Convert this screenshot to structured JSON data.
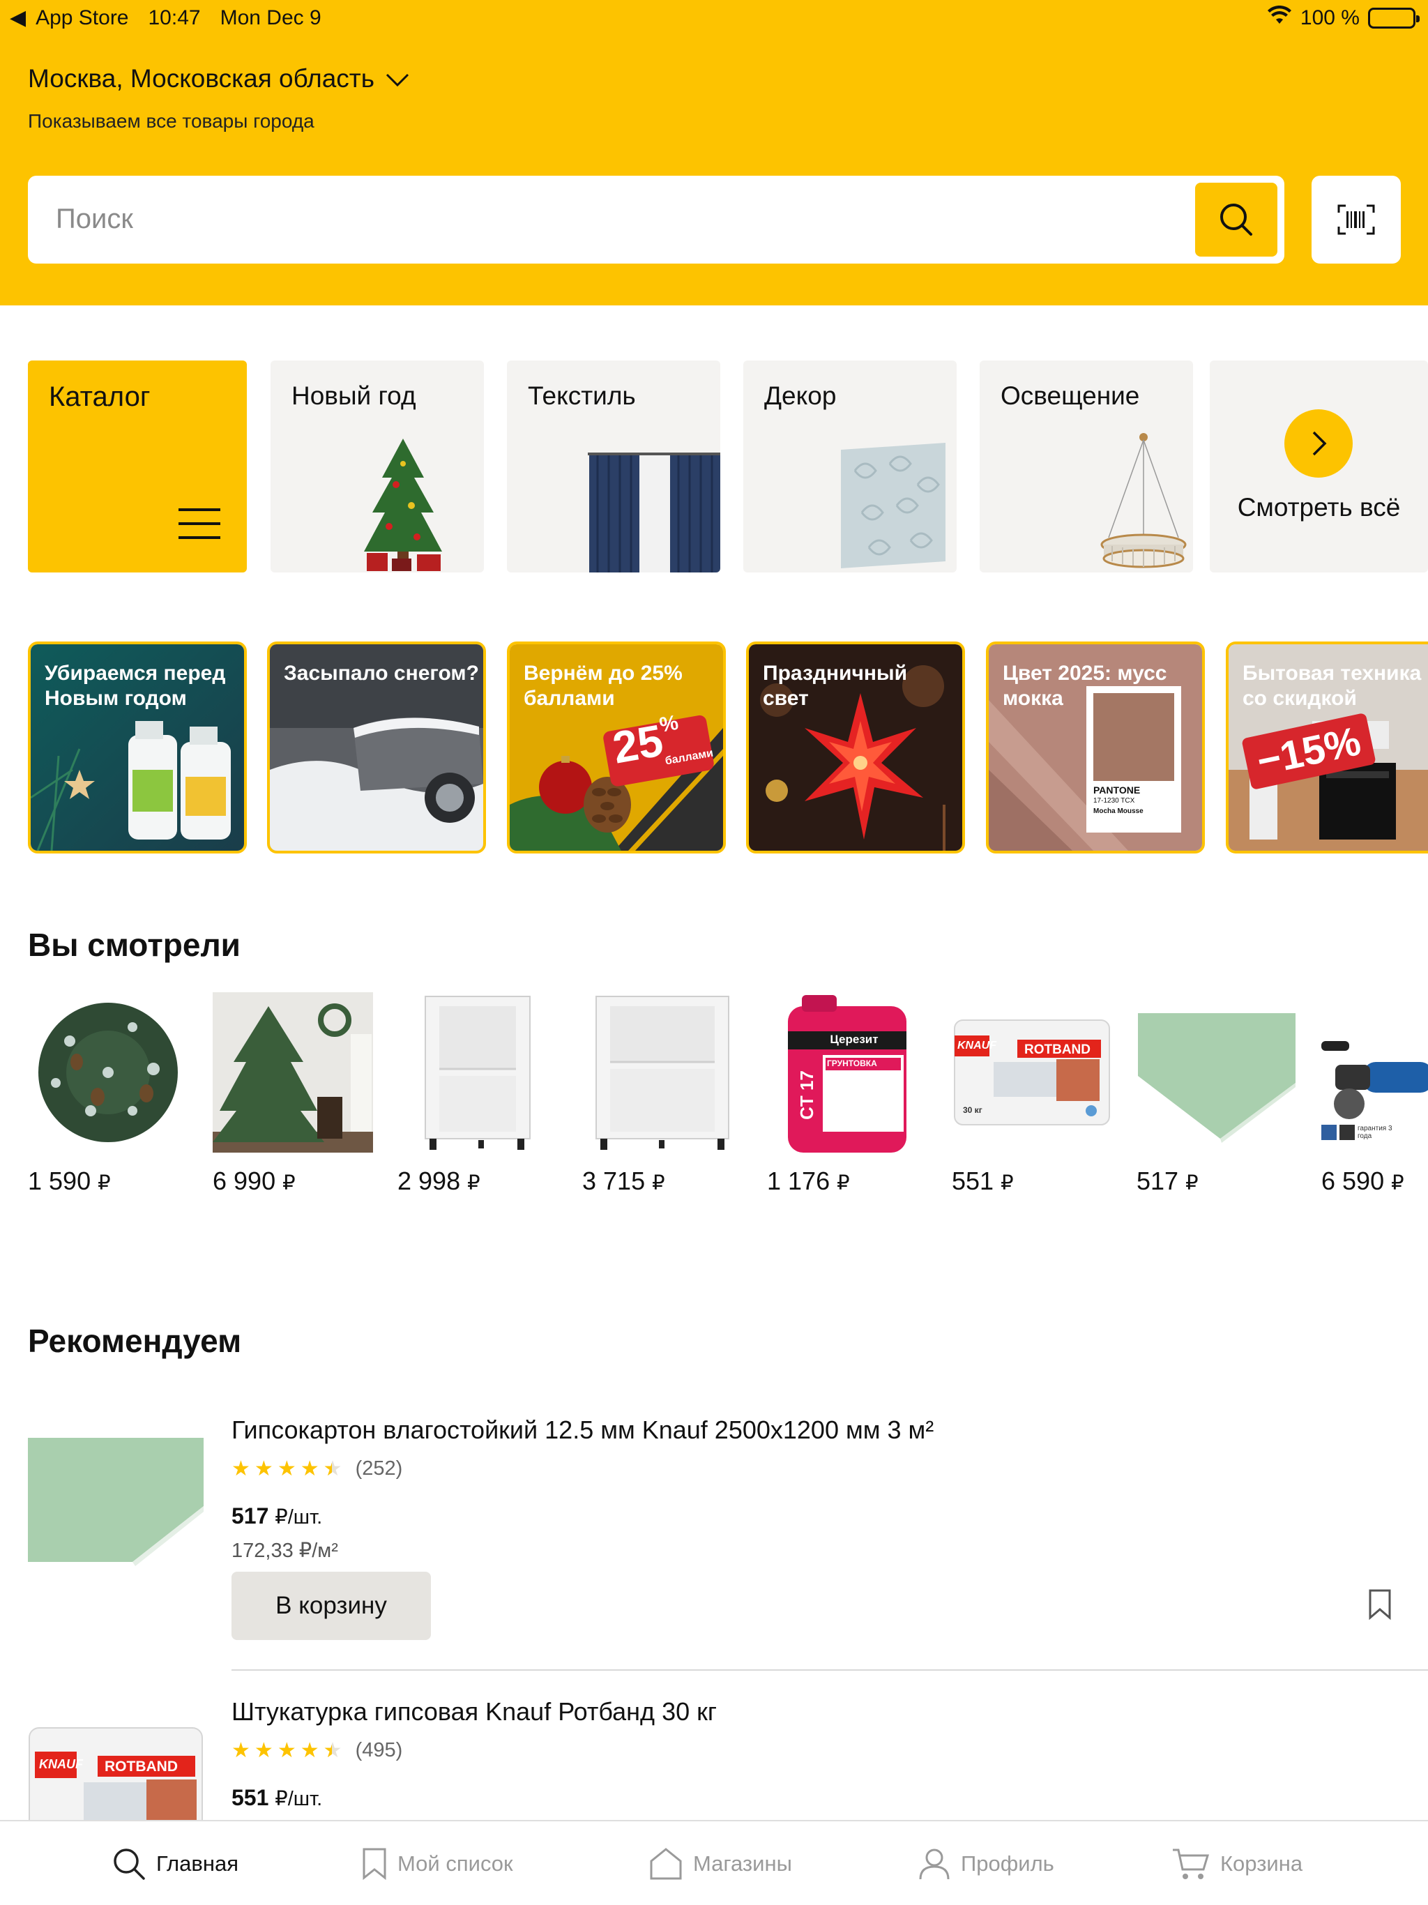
{
  "status_bar": {
    "back_app": "App Store",
    "time": "10:47",
    "date": "Mon Dec 9",
    "battery": "100 %"
  },
  "header": {
    "location": "Москва, Московская область",
    "location_sub": "Показываем все товары города",
    "search_placeholder": "Поиск",
    "accent_color": "#FDC300"
  },
  "categories": [
    {
      "label": "Каталог"
    },
    {
      "label": "Новый год"
    },
    {
      "label": "Текстиль"
    },
    {
      "label": "Декор"
    },
    {
      "label": "Освещение"
    },
    {
      "label": "Смотреть всё"
    }
  ],
  "promos": [
    {
      "title": "Убираемся перед Новым годом"
    },
    {
      "title": "Засыпало снегом?"
    },
    {
      "title": "Вернём до 25% баллами",
      "badge": "25",
      "badge_sub": "%",
      "badge_note": "баллами"
    },
    {
      "title": "Праздничный свет"
    },
    {
      "title": "Цвет 2025: мусс мокка",
      "swatch_brand": "PANTONE",
      "swatch_code": "17-1230 TCX",
      "swatch_name": "Mocha Mousse"
    },
    {
      "title": "Бытовая техника со скидкой",
      "badge": "−15%"
    }
  ],
  "viewed": {
    "title": "Вы смотрели",
    "items": [
      {
        "price": "1 590",
        "currency": "₽"
      },
      {
        "price": "6 990",
        "currency": "₽"
      },
      {
        "price": "2 998",
        "currency": "₽"
      },
      {
        "price": "3 715",
        "currency": "₽"
      },
      {
        "price": "1 176",
        "currency": "₽",
        "brand": "Церезит",
        "model": "CT 17",
        "kind": "ГРУНТОВКА"
      },
      {
        "price": "551",
        "currency": "₽",
        "brand": "KNAUF",
        "model": "ROTBAND",
        "weight": "30 кг"
      },
      {
        "price": "517",
        "currency": "₽"
      },
      {
        "price": "6 590",
        "currency": "₽",
        "note": "гарантия 3 года"
      }
    ]
  },
  "recommended": {
    "title": "Рекомендуем",
    "items": [
      {
        "title": "Гипсокартон влагостойкий 12.5 мм Knauf 2500x1200 мм 3 м²",
        "rating": 4.5,
        "reviews": "(252)",
        "price": "517",
        "price_unit": "₽/шт.",
        "unit_price": "172,33 ₽/м²",
        "cart_label": "В корзину"
      },
      {
        "title": "Штукатурка гипсовая Knauf Ротбанд 30 кг",
        "rating": 4.5,
        "reviews": "(495)",
        "price": "551",
        "price_unit": "₽/шт.",
        "brand": "KNAUF",
        "model": "ROTBAND"
      }
    ]
  },
  "tabbar": {
    "items": [
      {
        "label": "Главная",
        "icon": "search-icon",
        "active": true
      },
      {
        "label": "Мой список",
        "icon": "bookmark-icon"
      },
      {
        "label": "Магазины",
        "icon": "store-icon"
      },
      {
        "label": "Профиль",
        "icon": "profile-icon"
      },
      {
        "label": "Корзина",
        "icon": "cart-icon"
      }
    ]
  }
}
